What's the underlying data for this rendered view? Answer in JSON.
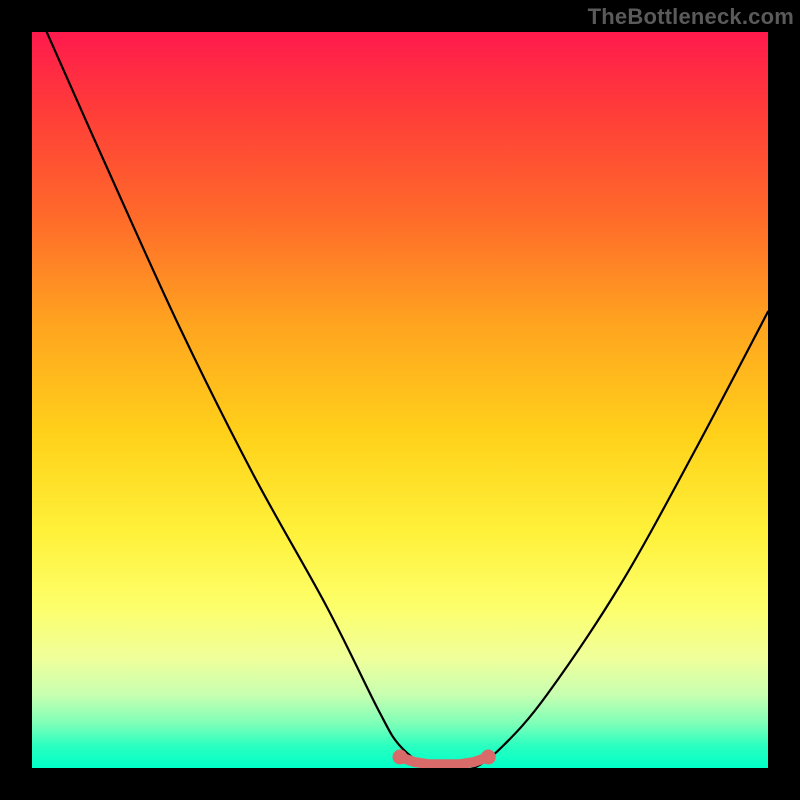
{
  "watermark": "TheBottleneck.com",
  "colors": {
    "frame": "#000000",
    "curve": "#000000",
    "marker": "#d86a6a",
    "gradient_top": "#ff1a4d",
    "gradient_bottom": "#00ffc8"
  },
  "chart_data": {
    "type": "line",
    "title": "",
    "xlabel": "",
    "ylabel": "",
    "xlim": [
      0,
      100
    ],
    "ylim": [
      0,
      100
    ],
    "grid": false,
    "legend": false,
    "series": [
      {
        "name": "bottleneck-curve",
        "x": [
          2,
          10,
          20,
          30,
          40,
          47,
          50,
          54,
          57,
          60,
          64,
          70,
          80,
          90,
          100
        ],
        "y": [
          100,
          82,
          60,
          40,
          22,
          8,
          3,
          0,
          0,
          0,
          3,
          10,
          25,
          43,
          62
        ]
      }
    ],
    "markers": [
      {
        "name": "flat-segment",
        "x": [
          50,
          52,
          54,
          56,
          58,
          60,
          62
        ],
        "y": [
          1.5,
          0.8,
          0.5,
          0.5,
          0.5,
          0.8,
          1.5
        ]
      }
    ]
  }
}
